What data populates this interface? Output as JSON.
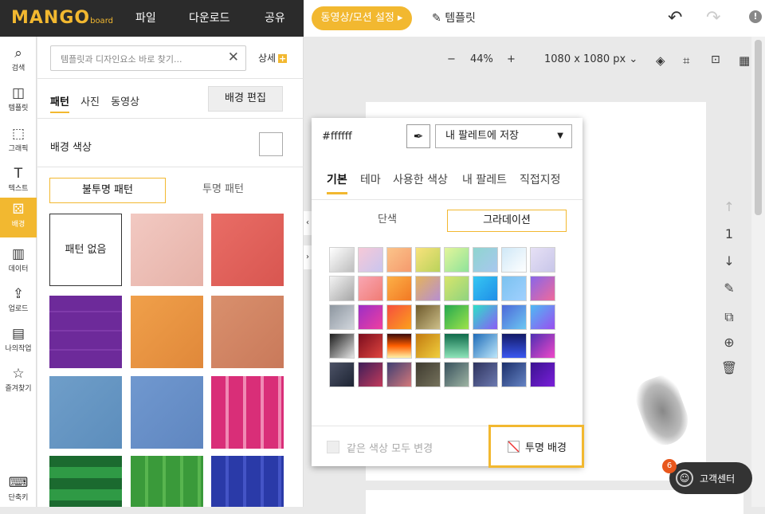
{
  "header": {
    "logo": "MANGO",
    "logo_sub": "board",
    "menu": [
      "파일",
      "다운로드",
      "공유"
    ],
    "video_btn": "동영상/모션 설정 ▸",
    "template_label": "템플릿",
    "undo": "↶",
    "redo": "↷",
    "info": "!"
  },
  "leftbar": {
    "items": [
      {
        "label": "검색",
        "icon": "⌕"
      },
      {
        "label": "템플릿",
        "icon": "◫"
      },
      {
        "label": "그래픽",
        "icon": "⬚"
      },
      {
        "label": "텍스트",
        "icon": "T"
      },
      {
        "label": "배경",
        "icon": "⚄"
      },
      {
        "label": "데이터",
        "icon": "▥"
      },
      {
        "label": "업로드",
        "icon": "⇪"
      },
      {
        "label": "나의작업",
        "icon": "▤"
      },
      {
        "label": "즐겨찾기",
        "icon": "☆"
      },
      {
        "label": "단축키",
        "icon": "⌨"
      }
    ]
  },
  "panel": {
    "search_placeholder": "템플릿과 디자인요소 바로 찾기...",
    "search_clear": "✕",
    "detail": "상세",
    "detail_plus": "+",
    "tabs": [
      "패턴",
      "사진",
      "동영상"
    ],
    "bg_edit": "배경 편집",
    "bg_color_label": "배경 색상",
    "opaque_tab": "불투명 패턴",
    "transparent_tab": "투명 패턴",
    "no_pattern": "패턴 없음"
  },
  "canvas": {
    "zoom_minus": "−",
    "zoom_value": "44%",
    "zoom_plus": "+",
    "size": "1080 x 1080 px",
    "size_caret": "⌄",
    "page_up": "↑",
    "page_number": "1",
    "page_down": "↓",
    "collapse_left": "‹",
    "collapse_right": "›"
  },
  "color_popup": {
    "hex": "#ffffff",
    "palette_select": "내 팔레트에 저장",
    "palette_caret": "▼",
    "tabs": [
      "기본",
      "테마",
      "사용한 색상",
      "내 팔레트",
      "직접지정"
    ],
    "solid_tab": "단색",
    "gradient_tab": "그라데이션",
    "same_color_label": "같은 색상 모두 변경",
    "transparent_bg": "투명 배경",
    "gradients": [
      "linear-gradient(135deg,#ffffff,#bdbdbd)",
      "linear-gradient(135deg,#f6c8d7,#c9c6ef)",
      "linear-gradient(135deg,#fbc48a,#f59a6d)",
      "linear-gradient(135deg,#f9e27c,#b9d35b)",
      "linear-gradient(135deg,#e3f59a,#8ee39a)",
      "linear-gradient(135deg,#8fd5cf,#a8c7ef)",
      "linear-gradient(135deg,#cfe8f7,#ffffff)",
      "linear-gradient(135deg,#e6e0f5,#c8c6e9)",
      "linear-gradient(135deg,#f3f3f3,#a6a6a6)",
      "linear-gradient(135deg,#f9a6b2,#f07c75)",
      "linear-gradient(135deg,#fcb047,#f27924)",
      "linear-gradient(135deg,#e4b35c,#b78fd1)",
      "linear-gradient(135deg,#d7e56b,#8fd47f)",
      "linear-gradient(135deg,#36c6f2,#1f8ee8)",
      "linear-gradient(135deg,#7bc2ef,#a0d0ff)",
      "linear-gradient(135deg,#8866e8,#f06a9b)",
      "linear-gradient(135deg,#8d96a0,#d2d7dd)",
      "linear-gradient(135deg,#9b2fc6,#f03fa0)",
      "linear-gradient(135deg,#f64e3e,#fba11c)",
      "linear-gradient(135deg,#6e5a2c,#cdbf89)",
      "linear-gradient(135deg,#24a850,#9ee34b)",
      "linear-gradient(135deg,#2fe0c8,#8a5cf6)",
      "linear-gradient(135deg,#4d68d8,#6cc7f2)",
      "linear-gradient(135deg,#4ebaf3,#9a4ef0)",
      "linear-gradient(135deg,#1c1c1c,#e5e5e5)",
      "linear-gradient(135deg,#7a0d1e,#e0453f)",
      "linear-gradient(180deg,#3a0a0a,#ff5e00,#fff2a8)",
      "linear-gradient(135deg,#c27a10,#f0cf3d)",
      "linear-gradient(180deg,#0f6b4a,#8de3b9)",
      "linear-gradient(135deg,#1f6cb8,#bde7fb)",
      "linear-gradient(180deg,#131a66,#3a57f0)",
      "linear-gradient(135deg,#4d2fb3,#ef48c8)",
      "linear-gradient(135deg,#4c5266,#1d2433)",
      "linear-gradient(135deg,#3e1f59,#c23a5b)",
      "linear-gradient(135deg,#3f3f73,#d4787a)",
      "linear-gradient(135deg,#3e3a2f,#75725c)",
      "linear-gradient(135deg,#37505c,#9eb4a3)",
      "linear-gradient(135deg,#2e335e,#6d7ab0)",
      "linear-gradient(135deg,#1b2f6b,#6684c4)",
      "linear-gradient(135deg,#3a1390,#7a1fd9)"
    ]
  },
  "patterns": [
    {
      "bg": "linear-gradient(135deg,#f2c9c2,#e6b2a8)"
    },
    {
      "bg": "linear-gradient(135deg,#e96d66,#d85650)"
    },
    {
      "bg": "repeating-linear-gradient(0deg,#6d2a9a 0 22px,#7f3aaa 22px 24px),#6d2a9a"
    },
    {
      "bg": "linear-gradient(135deg,#f0a04a,#e0883a)"
    },
    {
      "bg": "linear-gradient(135deg,#d9906d,#c9795a)"
    },
    {
      "bg": "linear-gradient(135deg,#6f9ec9,#5c8dbc)"
    },
    {
      "bg": "linear-gradient(135deg,#7098cf,#5f86c0)"
    },
    {
      "bg": "repeating-linear-gradient(90deg,#d92e78 0 18px,#f08ab4 18px 22px)"
    },
    {
      "bg": "repeating-linear-gradient(180deg,#1b6a2f 0 14px,#2f9a45 14px 28px)"
    },
    {
      "bg": "repeating-linear-gradient(90deg,#3a9a3a 0 18px,#58b54f 18px 22px)"
    },
    {
      "bg": "repeating-linear-gradient(90deg,#2a3aa8 0 18px,#4454c6 18px 22px)"
    }
  ],
  "support": {
    "label": "고객센터",
    "badge": "6",
    "face": "☺"
  },
  "side_tools": [
    "✎",
    "⧉",
    "⊕",
    "🗑"
  ]
}
